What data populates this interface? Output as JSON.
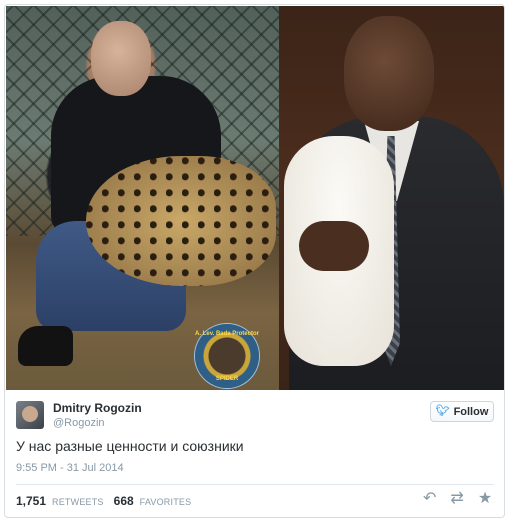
{
  "photos": {
    "left_description_icon": "photo-left",
    "right_description_icon": "photo-right",
    "badge": {
      "top_text": "A. Lev. Bada Protector",
      "bottom_text": "SPIDER"
    }
  },
  "tweet": {
    "author_name": "Dmitry Rogozin",
    "author_handle": "@Rogozin",
    "follow_label": "Follow",
    "text": "У нас разные ценности и союзники",
    "timestamp": "9:55 PM - 31 Jul 2014",
    "retweets_count": "1,751",
    "retweets_label": "RETWEETS",
    "favorites_count": "668",
    "favorites_label": "FAVORITES",
    "icons": {
      "follow": "twitter-bird-icon",
      "reply": "reply-icon",
      "retweet": "retweet-icon",
      "favorite": "star-icon"
    },
    "colors": {
      "accent": "#55acee",
      "text": "#292f33",
      "muted": "#8899a6"
    }
  }
}
